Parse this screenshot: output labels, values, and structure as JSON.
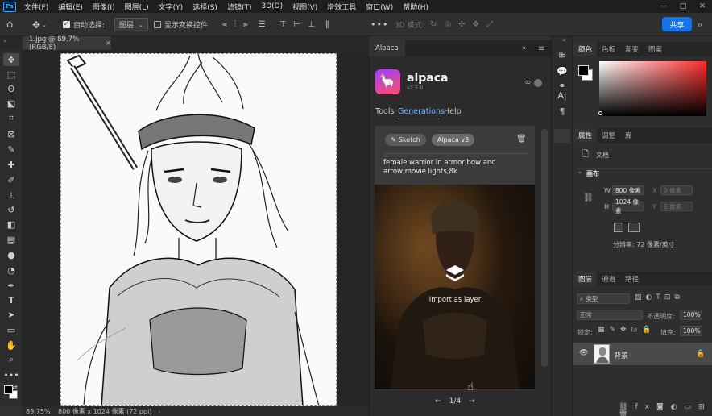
{
  "menubar": {
    "logo": "Ps",
    "items": [
      "文件(F)",
      "编辑(E)",
      "图像(I)",
      "图层(L)",
      "文字(Y)",
      "选择(S)",
      "滤镜(T)",
      "3D(D)",
      "视图(V)",
      "增效工具",
      "窗口(W)",
      "帮助(H)"
    ]
  },
  "options": {
    "auto_select_label": "自动选择:",
    "auto_select_value": "图层",
    "show_transform_label": "显示变换控件",
    "mode_3d_label": "3D 模式:",
    "more": "•••",
    "share": "共享"
  },
  "document": {
    "tab_label": "1.jpg @ 89.7%(RGB/8)",
    "zoom": "89.75%",
    "size_info": "800 像素 x 1024 像素 (72 ppi)"
  },
  "alpaca": {
    "panel_tab": "Alpaca",
    "brand": "alpaca",
    "version": "v2.5.0",
    "tabs": [
      "Tools",
      "Generations",
      "Help"
    ],
    "active_tab": "Generations",
    "chips": [
      "Sketch",
      "Alpaca v3"
    ],
    "prompt": "female warrior in armor,bow and arrow,movie lights,8k",
    "import_label": "Import as layer",
    "pager": "1/4"
  },
  "color_panel": {
    "tabs": [
      "颜色",
      "色板",
      "渐变",
      "图案"
    ]
  },
  "properties": {
    "tabs": [
      "属性",
      "调整",
      "库"
    ],
    "doc_label": "文档",
    "canvas_title": "画布",
    "w_label": "W",
    "w_value": "800 像素",
    "h_label": "H",
    "h_value": "1024 像素",
    "x_label": "X",
    "x_value": "0 像素",
    "y_label": "Y",
    "y_value": "0 像素",
    "resolution": "分辨率: 72 像素/英寸"
  },
  "layers": {
    "tabs": [
      "图层",
      "通道",
      "路径"
    ],
    "filter_kind": "类型",
    "blend_mode": "正常",
    "opacity_label": "不透明度:",
    "opacity_value": "100%",
    "lock_label": "锁定:",
    "fill_label": "填充:",
    "fill_value": "100%",
    "layer_name": "背景"
  },
  "colors": {
    "accent": "#1473e6",
    "link": "#7ab8ff"
  }
}
